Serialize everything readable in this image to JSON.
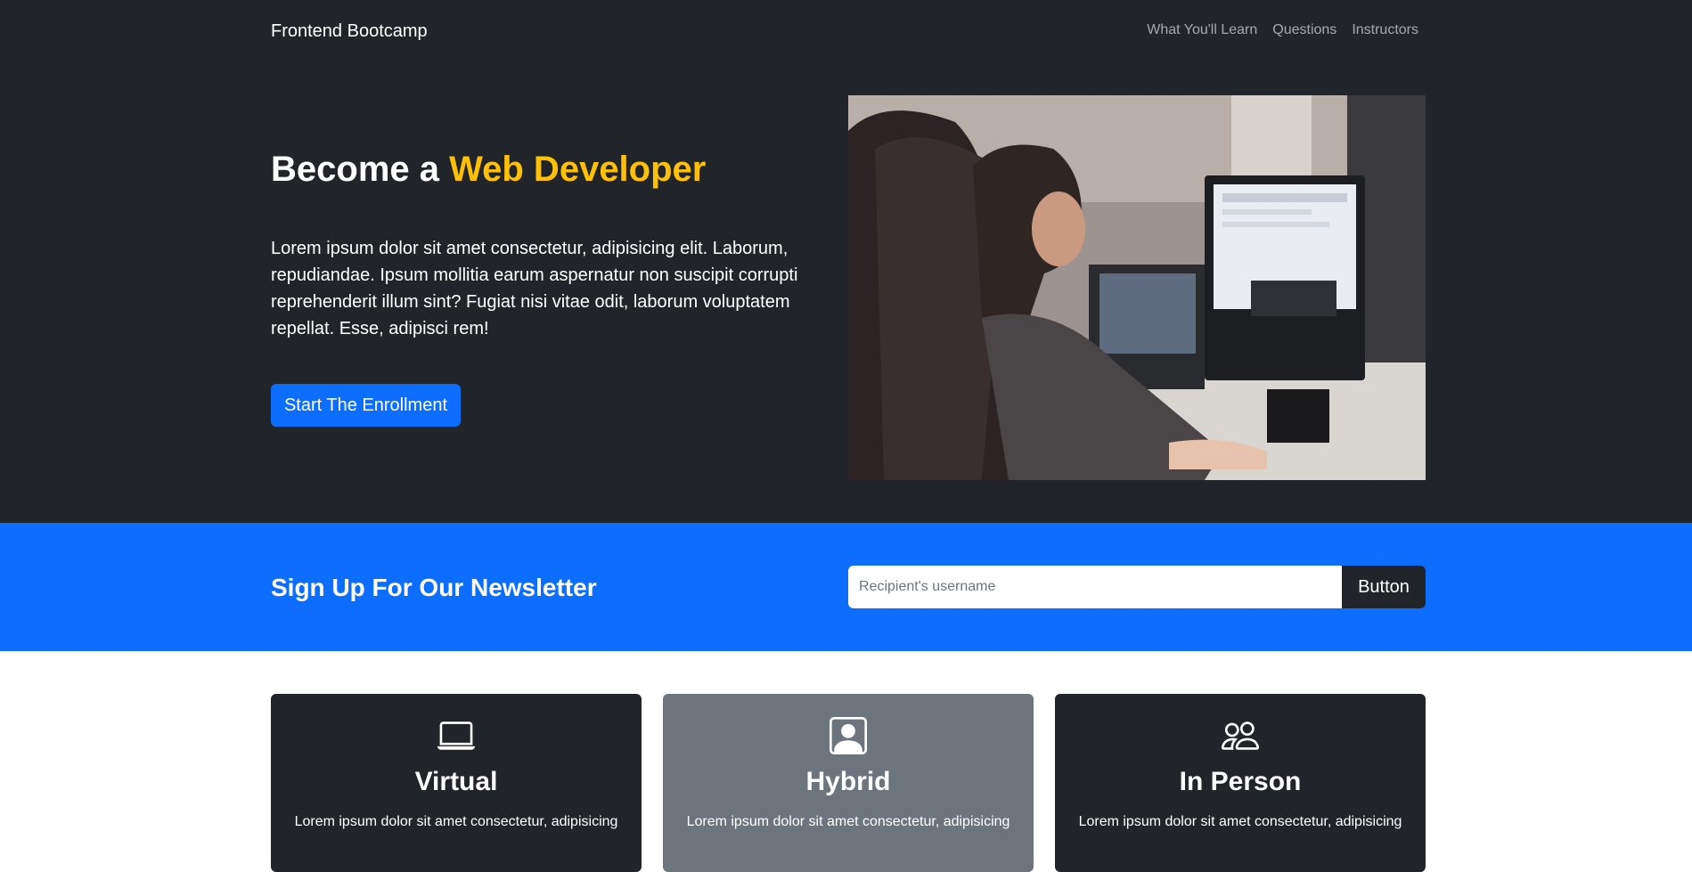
{
  "navbar": {
    "brand": "Frontend Bootcamp",
    "links": [
      "What You'll Learn",
      "Questions",
      "Instructors"
    ]
  },
  "hero": {
    "title_prefix": "Become a ",
    "title_accent": "Web Developer",
    "text": "Lorem ipsum dolor sit amet consectetur, adipisicing elit. Laborum, repudiandae. Ipsum mollitia earum aspernatur non suscipit corrupti reprehenderit illum sint? Fugiat nisi vitae odit, laborum voluptatem repellat. Esse, adipisci rem!",
    "cta_label": "Start The Enrollment"
  },
  "newsletter": {
    "title": "Sign Up For Our Newsletter",
    "placeholder": "Recipient's username",
    "button_label": "Button"
  },
  "cards": [
    {
      "icon": "laptop-icon",
      "title": "Virtual",
      "text": "Lorem ipsum dolor sit amet consectetur, adipisicing"
    },
    {
      "icon": "person-square-icon",
      "title": "Hybrid",
      "text": "Lorem ipsum dolor sit amet consectetur, adipisicing"
    },
    {
      "icon": "people-icon",
      "title": "In Person",
      "text": "Lorem ipsum dolor sit amet consectetur, adipisicing"
    }
  ],
  "colors": {
    "dark": "#212529",
    "primary": "#0d6efd",
    "warning": "#ffc107",
    "secondary": "#6c757d"
  }
}
